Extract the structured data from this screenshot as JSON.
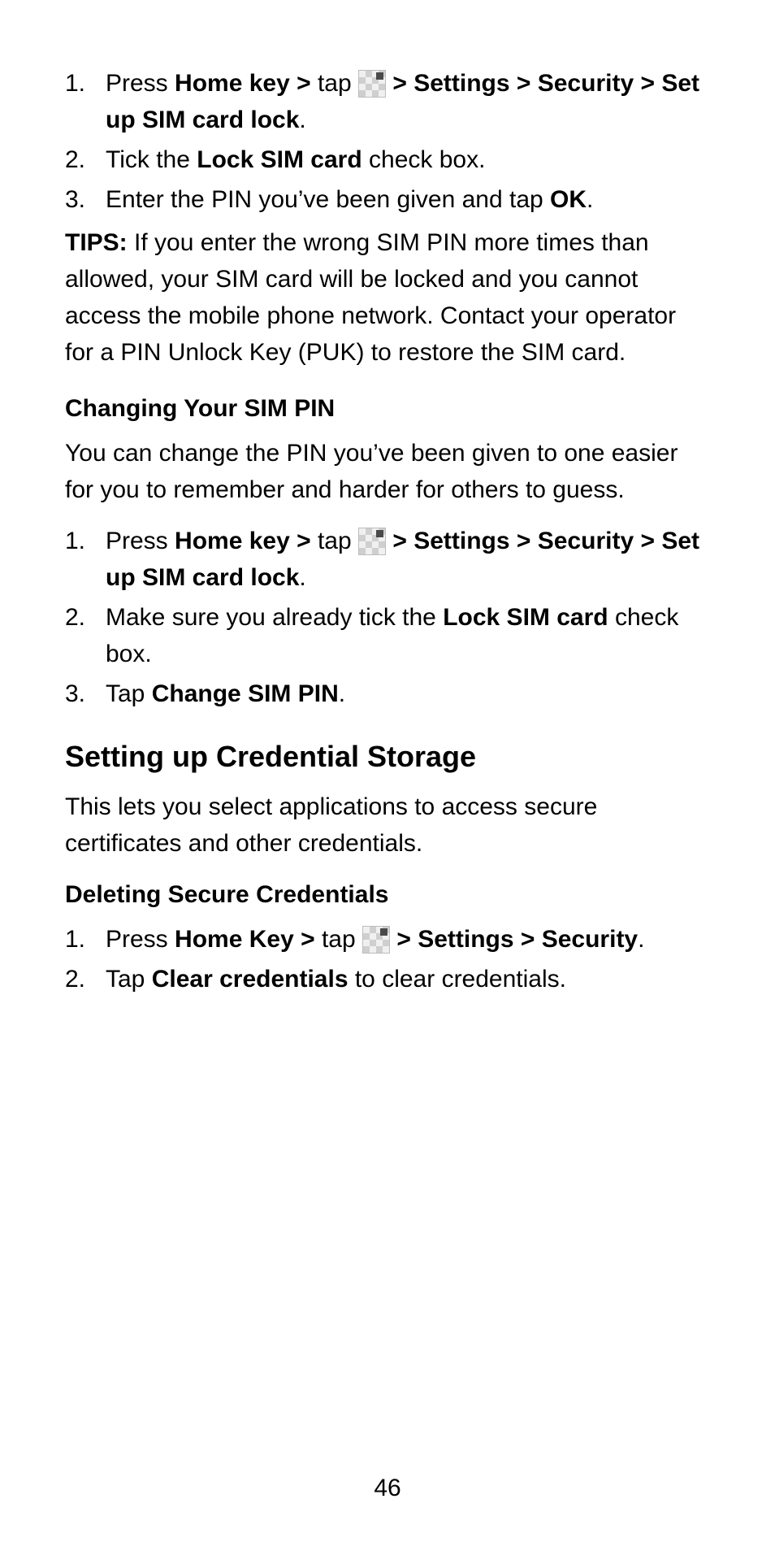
{
  "page_number": "46",
  "steps_a": {
    "items": [
      {
        "num": "1.",
        "pre": "Press ",
        "bold1": "Home key > ",
        "mid": "tap ",
        "post_bold": " > Settings > Security > Set up SIM card lock",
        "tail": "."
      },
      {
        "num": "2.",
        "pre": "Tick the ",
        "bold1": "Lock SIM card",
        "tail": " check box."
      },
      {
        "num": "3.",
        "pre": "Enter the PIN you’ve been given and tap ",
        "bold1": "OK",
        "tail": "."
      }
    ]
  },
  "tips": {
    "label": "TIPS:",
    "text": " If you enter the wrong SIM PIN more times than allowed, your SIM card will be locked and you cannot access the mobile phone network. Contact your operator for a PIN Unlock Key (PUK) to restore the SIM card."
  },
  "subheading_change": "Changing Your SIM PIN",
  "change_intro": "You can change the PIN you’ve been given to one easier for you to remember and harder for others to guess.",
  "steps_b": {
    "items": [
      {
        "num": "1.",
        "pre": "Press ",
        "bold1": "Home key > ",
        "mid": "tap ",
        "post_bold": " > Settings > Security > Set up SIM card lock",
        "tail": "."
      },
      {
        "num": "2.",
        "pre": "Make sure you already tick the ",
        "bold1": "Lock SIM card",
        "tail": " check box."
      },
      {
        "num": "3.",
        "pre": "Tap ",
        "bold1": "Change SIM PIN",
        "tail": "."
      }
    ]
  },
  "section_heading": "Setting up Credential Storage",
  "section_intro": "This lets you select applications to access secure certificates and other credentials.",
  "subheading_delete": "Deleting Secure Credentials",
  "steps_c": {
    "items": [
      {
        "num": "1.",
        "pre": "Press ",
        "bold1": "Home Key > ",
        "mid": "tap ",
        "post_bold": " > Settings > Security",
        "tail": "."
      },
      {
        "num": "2.",
        "pre": "Tap ",
        "bold1": "Clear credentials",
        "tail": " to clear credentials."
      }
    ]
  }
}
